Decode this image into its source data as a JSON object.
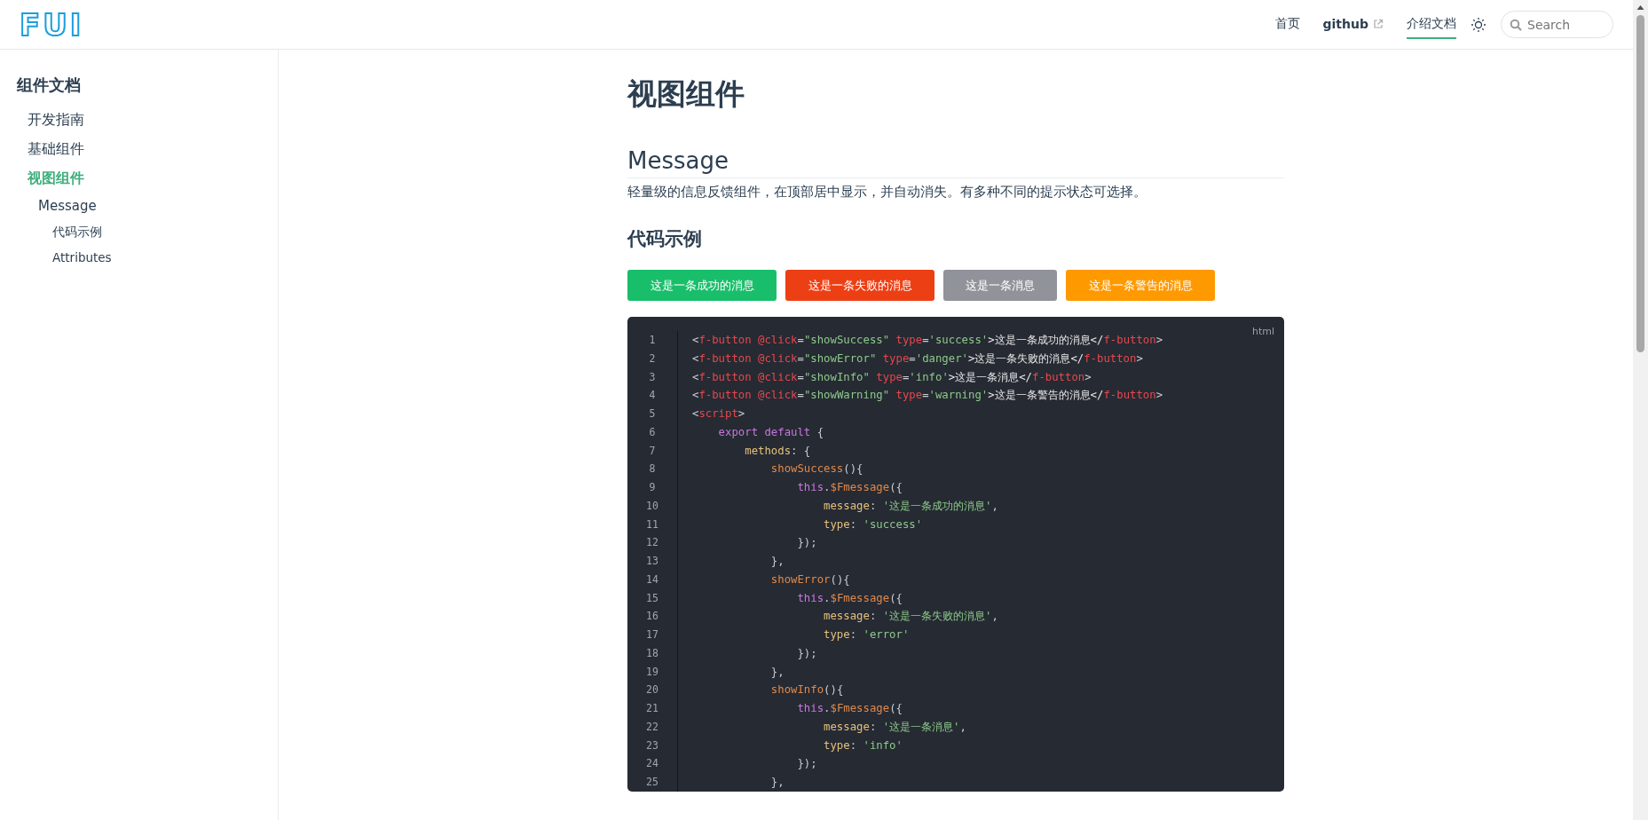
{
  "header": {
    "logo": "FUI",
    "nav": [
      {
        "label": "首页",
        "external": false,
        "selected": false
      },
      {
        "label": "github",
        "external": true,
        "selected": false
      },
      {
        "label": "介绍文档",
        "external": false,
        "selected": true
      }
    ],
    "search": {
      "placeholder": "Search"
    }
  },
  "sidebar": {
    "title": "组件文档",
    "items": [
      {
        "label": "开发指南",
        "selected": false
      },
      {
        "label": "基础组件",
        "selected": false
      },
      {
        "label": "视图组件",
        "selected": true,
        "children": [
          {
            "label": "Message",
            "selected": false,
            "children": [
              {
                "label": "代码示例",
                "selected": false
              },
              {
                "label": "Attributes",
                "selected": false
              }
            ]
          }
        ]
      }
    ]
  },
  "page": {
    "title": "视图组件",
    "section": "Message",
    "description": "轻量级的信息反馈组件，在顶部居中显示，并自动消失。有多种不同的提示状态可选择。",
    "subsection": "代码示例",
    "buttons": [
      {
        "label": "这是一条成功的消息",
        "color": "#19be6b"
      },
      {
        "label": "这是一条失败的消息",
        "color": "#ed3f14"
      },
      {
        "label": "这是一条消息",
        "color": "#909399"
      },
      {
        "label": "这是一条警告的消息",
        "color": "#ff9900"
      }
    ],
    "code": {
      "language": "html",
      "lines": [
        {
          "number": "1",
          "tokens": [
            {
              "kind": "punct",
              "text": "<"
            },
            {
              "kind": "tag",
              "text": "f-button"
            },
            {
              "kind": "attr",
              "text": " @click"
            },
            {
              "kind": "punct",
              "text": "="
            },
            {
              "kind": "str",
              "text": "\"showSuccess\""
            },
            {
              "kind": "attr",
              "text": " type"
            },
            {
              "kind": "punct",
              "text": "="
            },
            {
              "kind": "str",
              "text": "'success'"
            },
            {
              "kind": "text",
              "text": ">这是一条成功的消息</"
            },
            {
              "kind": "tag",
              "text": "f-button"
            },
            {
              "kind": "punct",
              "text": ">"
            }
          ]
        },
        {
          "number": "2",
          "tokens": [
            {
              "kind": "punct",
              "text": "<"
            },
            {
              "kind": "tag",
              "text": "f-button"
            },
            {
              "kind": "attr",
              "text": " @click"
            },
            {
              "kind": "punct",
              "text": "="
            },
            {
              "kind": "str",
              "text": "\"showError\""
            },
            {
              "kind": "attr",
              "text": " type"
            },
            {
              "kind": "punct",
              "text": "="
            },
            {
              "kind": "str",
              "text": "'danger'"
            },
            {
              "kind": "text",
              "text": ">这是一条失败的消息</"
            },
            {
              "kind": "tag",
              "text": "f-button"
            },
            {
              "kind": "punct",
              "text": ">"
            }
          ]
        },
        {
          "number": "3",
          "tokens": [
            {
              "kind": "punct",
              "text": "<"
            },
            {
              "kind": "tag",
              "text": "f-button"
            },
            {
              "kind": "attr",
              "text": " @click"
            },
            {
              "kind": "punct",
              "text": "="
            },
            {
              "kind": "str",
              "text": "\"showInfo\""
            },
            {
              "kind": "attr",
              "text": " type"
            },
            {
              "kind": "punct",
              "text": "="
            },
            {
              "kind": "str",
              "text": "'info'"
            },
            {
              "kind": "text",
              "text": ">这是一条消息</"
            },
            {
              "kind": "tag",
              "text": "f-button"
            },
            {
              "kind": "punct",
              "text": ">"
            }
          ]
        },
        {
          "number": "4",
          "tokens": [
            {
              "kind": "punct",
              "text": "<"
            },
            {
              "kind": "tag",
              "text": "f-button"
            },
            {
              "kind": "attr",
              "text": " @click"
            },
            {
              "kind": "punct",
              "text": "="
            },
            {
              "kind": "str",
              "text": "\"showWarning\""
            },
            {
              "kind": "attr",
              "text": " type"
            },
            {
              "kind": "punct",
              "text": "="
            },
            {
              "kind": "str",
              "text": "'warning'"
            },
            {
              "kind": "text",
              "text": ">这是一条警告的消息</"
            },
            {
              "kind": "tag",
              "text": "f-button"
            },
            {
              "kind": "punct",
              "text": ">"
            }
          ]
        },
        {
          "number": "5",
          "tokens": [
            {
              "kind": "punct",
              "text": "<"
            },
            {
              "kind": "tag",
              "text": "script"
            },
            {
              "kind": "punct",
              "text": ">"
            }
          ]
        },
        {
          "number": "6",
          "tokens": [
            {
              "kind": "keyword",
              "text": "    export default"
            },
            {
              "kind": "punct",
              "text": " {"
            }
          ]
        },
        {
          "number": "7",
          "tokens": [
            {
              "kind": "prop",
              "text": "        methods"
            },
            {
              "kind": "punct",
              "text": ": {"
            }
          ]
        },
        {
          "number": "8",
          "tokens": [
            {
              "kind": "func",
              "text": "            showSuccess"
            },
            {
              "kind": "punct",
              "text": "(){"
            }
          ]
        },
        {
          "number": "9",
          "tokens": [
            {
              "kind": "keyword",
              "text": "                this"
            },
            {
              "kind": "punct",
              "text": "."
            },
            {
              "kind": "func",
              "text": "$Fmessage"
            },
            {
              "kind": "punct",
              "text": "({"
            }
          ]
        },
        {
          "number": "10",
          "tokens": [
            {
              "kind": "prop",
              "text": "                    message"
            },
            {
              "kind": "punct",
              "text": ": "
            },
            {
              "kind": "str",
              "text": "'这是一条成功的消息'"
            },
            {
              "kind": "punct",
              "text": ","
            }
          ]
        },
        {
          "number": "11",
          "tokens": [
            {
              "kind": "prop",
              "text": "                    type"
            },
            {
              "kind": "punct",
              "text": ": "
            },
            {
              "kind": "str",
              "text": "'success'"
            }
          ]
        },
        {
          "number": "12",
          "tokens": [
            {
              "kind": "punct",
              "text": "                });"
            }
          ]
        },
        {
          "number": "13",
          "tokens": [
            {
              "kind": "punct",
              "text": "            },"
            }
          ]
        },
        {
          "number": "14",
          "tokens": [
            {
              "kind": "func",
              "text": "            showError"
            },
            {
              "kind": "punct",
              "text": "(){"
            }
          ]
        },
        {
          "number": "15",
          "tokens": [
            {
              "kind": "keyword",
              "text": "                this"
            },
            {
              "kind": "punct",
              "text": "."
            },
            {
              "kind": "func",
              "text": "$Fmessage"
            },
            {
              "kind": "punct",
              "text": "({"
            }
          ]
        },
        {
          "number": "16",
          "tokens": [
            {
              "kind": "prop",
              "text": "                    message"
            },
            {
              "kind": "punct",
              "text": ": "
            },
            {
              "kind": "str",
              "text": "'这是一条失败的消息'"
            },
            {
              "kind": "punct",
              "text": ","
            }
          ]
        },
        {
          "number": "17",
          "tokens": [
            {
              "kind": "prop",
              "text": "                    type"
            },
            {
              "kind": "punct",
              "text": ": "
            },
            {
              "kind": "str",
              "text": "'error'"
            }
          ]
        },
        {
          "number": "18",
          "tokens": [
            {
              "kind": "punct",
              "text": "                });"
            }
          ]
        },
        {
          "number": "19",
          "tokens": [
            {
              "kind": "punct",
              "text": "            },"
            }
          ]
        },
        {
          "number": "20",
          "tokens": [
            {
              "kind": "func",
              "text": "            showInfo"
            },
            {
              "kind": "punct",
              "text": "(){"
            }
          ]
        },
        {
          "number": "21",
          "tokens": [
            {
              "kind": "keyword",
              "text": "                this"
            },
            {
              "kind": "punct",
              "text": "."
            },
            {
              "kind": "func",
              "text": "$Fmessage"
            },
            {
              "kind": "punct",
              "text": "({"
            }
          ]
        },
        {
          "number": "22",
          "tokens": [
            {
              "kind": "prop",
              "text": "                    message"
            },
            {
              "kind": "punct",
              "text": ": "
            },
            {
              "kind": "str",
              "text": "'这是一条消息'"
            },
            {
              "kind": "punct",
              "text": ","
            }
          ]
        },
        {
          "number": "23",
          "tokens": [
            {
              "kind": "prop",
              "text": "                    type"
            },
            {
              "kind": "punct",
              "text": ": "
            },
            {
              "kind": "str",
              "text": "'info'"
            }
          ]
        },
        {
          "number": "24",
          "tokens": [
            {
              "kind": "punct",
              "text": "                });"
            }
          ]
        },
        {
          "number": "25",
          "tokens": [
            {
              "kind": "punct",
              "text": "            },"
            }
          ]
        }
      ]
    }
  }
}
